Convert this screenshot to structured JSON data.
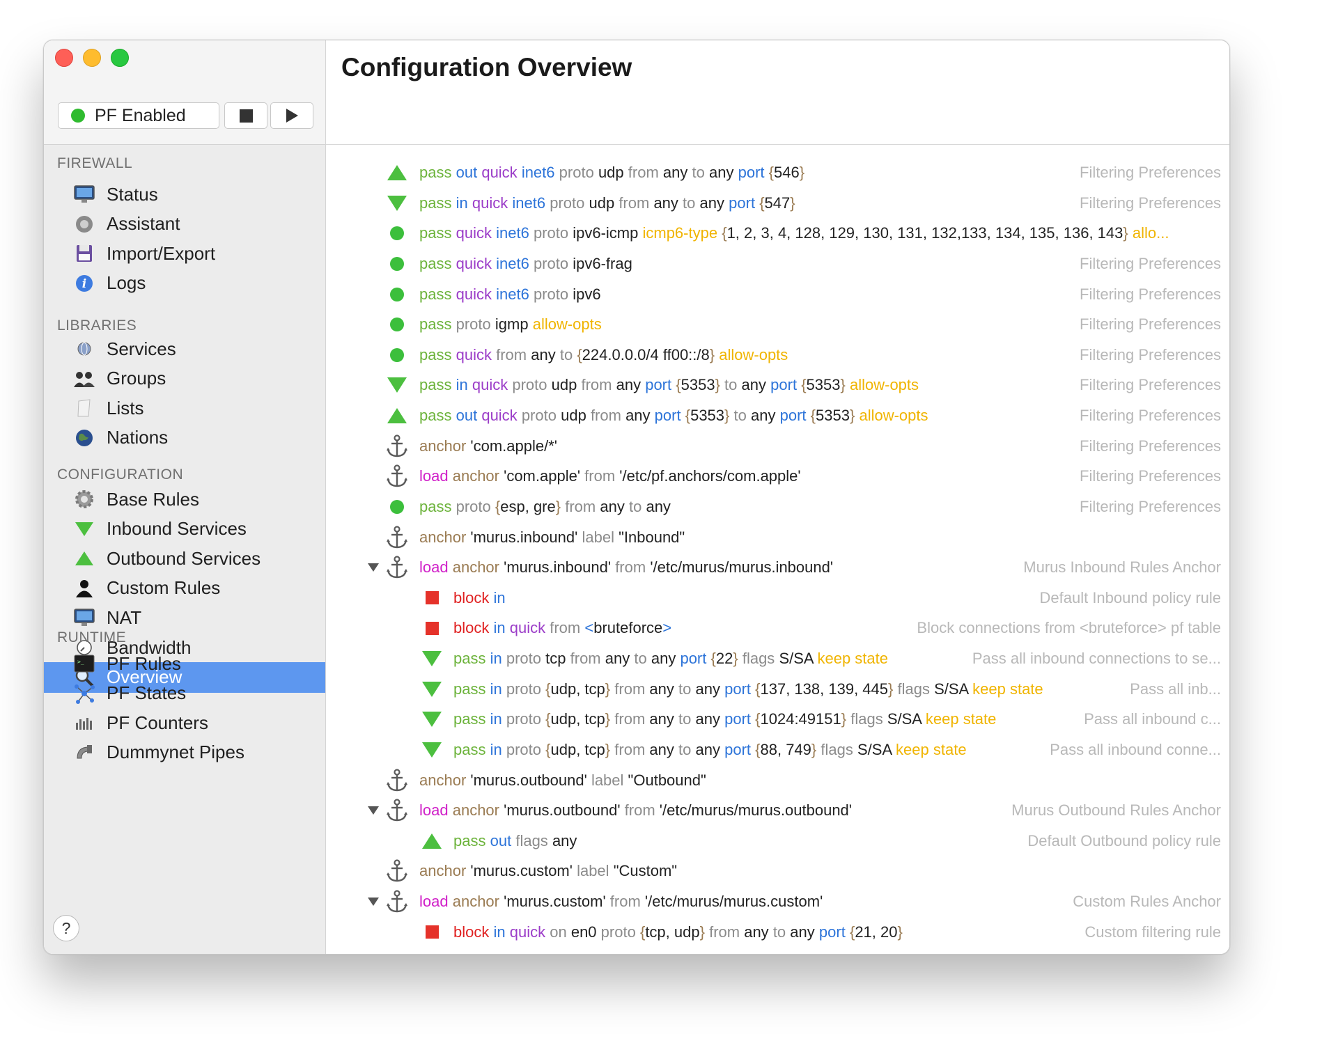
{
  "window": {
    "pf_status": "PF Enabled",
    "title": "Configuration Overview"
  },
  "sidebar": {
    "sections": [
      {
        "label": "FIREWALL",
        "items": [
          {
            "label": "Status",
            "icon": "monitor-icon"
          },
          {
            "label": "Assistant",
            "icon": "assistant-icon"
          },
          {
            "label": "Import/Export",
            "icon": "disk-icon"
          },
          {
            "label": "Logs",
            "icon": "info-icon"
          }
        ]
      },
      {
        "label": "LIBRARIES",
        "items": [
          {
            "label": "Services",
            "icon": "globe-icon"
          },
          {
            "label": "Groups",
            "icon": "group-icon"
          },
          {
            "label": "Lists",
            "icon": "list-icon"
          },
          {
            "label": "Nations",
            "icon": "earth-icon"
          }
        ]
      },
      {
        "label": "CONFIGURATION",
        "items": [
          {
            "label": "Base Rules",
            "icon": "gear-icon"
          },
          {
            "label": "Inbound Services",
            "icon": "down-triangle-icon"
          },
          {
            "label": "Outbound Services",
            "icon": "up-triangle-icon"
          },
          {
            "label": "Custom Rules",
            "icon": "user-icon"
          },
          {
            "label": "NAT",
            "icon": "monitor-icon"
          },
          {
            "label": "Bandwidth",
            "icon": "gauge-icon"
          },
          {
            "label": "Overview",
            "icon": "magnifier-icon",
            "selected": true
          }
        ]
      },
      {
        "label": "RUNTIME",
        "items": [
          {
            "label": "PF Rules",
            "icon": "terminal-icon"
          },
          {
            "label": "PF States",
            "icon": "network-icon"
          },
          {
            "label": "PF Counters",
            "icon": "bars-icon"
          },
          {
            "label": "Dummynet Pipes",
            "icon": "pipe-icon"
          }
        ]
      }
    ],
    "help": "?"
  },
  "rules": [
    {
      "icon": "up",
      "indent": 0,
      "tokens": [
        [
          "pass",
          "pass"
        ],
        [
          "dir",
          "out"
        ],
        [
          "q",
          "quick"
        ],
        [
          "af",
          "inet6"
        ],
        [
          "kw",
          "proto"
        ],
        [
          "v",
          "udp"
        ],
        [
          "kw",
          "from"
        ],
        [
          "v",
          "any"
        ],
        [
          "kw",
          "to"
        ],
        [
          "v",
          "any"
        ],
        [
          "dir",
          "port"
        ],
        [
          "br",
          "{"
        ],
        [
          "v",
          "546"
        ],
        [
          "br",
          "}"
        ]
      ],
      "note": "Filtering Preferences"
    },
    {
      "icon": "down",
      "indent": 0,
      "tokens": [
        [
          "pass",
          "pass"
        ],
        [
          "dir",
          "in"
        ],
        [
          "q",
          "quick"
        ],
        [
          "af",
          "inet6"
        ],
        [
          "kw",
          "proto"
        ],
        [
          "v",
          "udp"
        ],
        [
          "kw",
          "from"
        ],
        [
          "v",
          "any"
        ],
        [
          "kw",
          "to"
        ],
        [
          "v",
          "any"
        ],
        [
          "dir",
          "port"
        ],
        [
          "br",
          "{"
        ],
        [
          "v",
          "547"
        ],
        [
          "br",
          "}"
        ]
      ],
      "note": "Filtering Preferences"
    },
    {
      "icon": "dot",
      "indent": 0,
      "tokens": [
        [
          "pass",
          "pass"
        ],
        [
          "q",
          "quick"
        ],
        [
          "af",
          "inet6"
        ],
        [
          "kw",
          "proto"
        ],
        [
          "v",
          "ipv6-icmp"
        ],
        [
          "y",
          "icmp6-type"
        ],
        [
          "br",
          "{"
        ],
        [
          "v",
          "1, 2, 3, 4, 128, 129, 130, 131, 132,133, 134, 135, 136, 143"
        ],
        [
          "br",
          "}"
        ],
        [
          "y",
          "allo..."
        ]
      ],
      "note": ""
    },
    {
      "icon": "dot",
      "indent": 0,
      "tokens": [
        [
          "pass",
          "pass"
        ],
        [
          "q",
          "quick"
        ],
        [
          "af",
          "inet6"
        ],
        [
          "kw",
          "proto"
        ],
        [
          "v",
          "ipv6-frag"
        ]
      ],
      "note": "Filtering Preferences"
    },
    {
      "icon": "dot",
      "indent": 0,
      "tokens": [
        [
          "pass",
          "pass"
        ],
        [
          "q",
          "quick"
        ],
        [
          "af",
          "inet6"
        ],
        [
          "kw",
          "proto"
        ],
        [
          "v",
          "ipv6"
        ]
      ],
      "note": "Filtering Preferences"
    },
    {
      "icon": "dot",
      "indent": 0,
      "tokens": [
        [
          "pass",
          "pass"
        ],
        [
          "kw",
          "proto"
        ],
        [
          "v",
          "igmp"
        ],
        [
          "y",
          "allow-opts"
        ]
      ],
      "note": "Filtering Preferences"
    },
    {
      "icon": "dot",
      "indent": 0,
      "tokens": [
        [
          "pass",
          "pass"
        ],
        [
          "q",
          "quick"
        ],
        [
          "kw",
          "from"
        ],
        [
          "v",
          "any"
        ],
        [
          "kw",
          "to"
        ],
        [
          "br",
          "{"
        ],
        [
          "v",
          "224.0.0.0/4 ff00::/8"
        ],
        [
          "br",
          "}"
        ],
        [
          "y",
          "allow-opts"
        ]
      ],
      "note": "Filtering Preferences"
    },
    {
      "icon": "down",
      "indent": 0,
      "tokens": [
        [
          "pass",
          "pass"
        ],
        [
          "dir",
          "in"
        ],
        [
          "q",
          "quick"
        ],
        [
          "kw",
          "proto"
        ],
        [
          "v",
          "udp"
        ],
        [
          "kw",
          "from"
        ],
        [
          "v",
          "any"
        ],
        [
          "dir",
          "port"
        ],
        [
          "br",
          "{"
        ],
        [
          "v",
          "5353"
        ],
        [
          "br",
          "}"
        ],
        [
          "kw",
          "to"
        ],
        [
          "v",
          "any"
        ],
        [
          "dir",
          "port"
        ],
        [
          "br",
          "{"
        ],
        [
          "v",
          "5353"
        ],
        [
          "br",
          "}"
        ],
        [
          "y",
          "allow-opts"
        ]
      ],
      "note": "Filtering Preferences"
    },
    {
      "icon": "up",
      "indent": 0,
      "tokens": [
        [
          "pass",
          "pass"
        ],
        [
          "dir",
          "out"
        ],
        [
          "q",
          "quick"
        ],
        [
          "kw",
          "proto"
        ],
        [
          "v",
          "udp"
        ],
        [
          "kw",
          "from"
        ],
        [
          "v",
          "any"
        ],
        [
          "dir",
          "port"
        ],
        [
          "br",
          "{"
        ],
        [
          "v",
          "5353"
        ],
        [
          "br",
          "}"
        ],
        [
          "kw",
          "to"
        ],
        [
          "v",
          "any"
        ],
        [
          "dir",
          "port"
        ],
        [
          "br",
          "{"
        ],
        [
          "v",
          "5353"
        ],
        [
          "br",
          "}"
        ],
        [
          "y",
          "allow-opts"
        ]
      ],
      "note": "Filtering Preferences"
    },
    {
      "icon": "anchor",
      "indent": 0,
      "tokens": [
        [
          "anchor",
          "anchor"
        ],
        [
          "v",
          "'com.apple/*'"
        ]
      ],
      "note": "Filtering Preferences"
    },
    {
      "icon": "anchor",
      "indent": 0,
      "tokens": [
        [
          "load",
          "load"
        ],
        [
          "anchor",
          "anchor"
        ],
        [
          "v",
          "'com.apple'"
        ],
        [
          "kw",
          "from"
        ],
        [
          "v",
          "'/etc/pf.anchors/com.apple'"
        ]
      ],
      "note": "Filtering Preferences"
    },
    {
      "icon": "dot",
      "indent": 0,
      "tokens": [
        [
          "pass",
          "pass"
        ],
        [
          "kw",
          "proto"
        ],
        [
          "br",
          "{"
        ],
        [
          "v",
          "esp, gre"
        ],
        [
          "br",
          "}"
        ],
        [
          "kw",
          "from"
        ],
        [
          "v",
          "any"
        ],
        [
          "kw",
          "to"
        ],
        [
          "v",
          "any"
        ]
      ],
      "note": "Filtering Preferences"
    },
    {
      "icon": "anchor",
      "indent": 0,
      "tokens": [
        [
          "anchor",
          "anchor"
        ],
        [
          "v",
          "'murus.inbound'"
        ],
        [
          "kw",
          "label"
        ],
        [
          "v",
          "\"Inbound\""
        ]
      ],
      "note": ""
    },
    {
      "icon": "anchor",
      "indent": 0,
      "disclosure": true,
      "tokens": [
        [
          "load",
          "load"
        ],
        [
          "anchor",
          "anchor"
        ],
        [
          "v",
          "'murus.inbound'"
        ],
        [
          "kw",
          "from"
        ],
        [
          "v",
          "'/etc/murus/murus.inbound'"
        ]
      ],
      "note": "Murus Inbound Rules Anchor"
    },
    {
      "icon": "sq",
      "indent": 1,
      "tokens": [
        [
          "block",
          "block"
        ],
        [
          "dir",
          "in"
        ]
      ],
      "note": "Default Inbound policy rule"
    },
    {
      "icon": "sq",
      "indent": 1,
      "tokens": [
        [
          "block",
          "block"
        ],
        [
          "dir",
          "in"
        ],
        [
          "q",
          "quick"
        ],
        [
          "kw",
          "from"
        ],
        [
          "dir",
          "<"
        ],
        [
          "v",
          "bruteforce"
        ],
        [
          "dir",
          ">"
        ]
      ],
      "note": "Block connections from <bruteforce> pf table"
    },
    {
      "icon": "down",
      "indent": 1,
      "tokens": [
        [
          "pass",
          "pass"
        ],
        [
          "dir",
          "in"
        ],
        [
          "kw",
          "proto"
        ],
        [
          "v",
          "tcp"
        ],
        [
          "kw",
          "from"
        ],
        [
          "v",
          "any"
        ],
        [
          "kw",
          "to"
        ],
        [
          "v",
          "any"
        ],
        [
          "dir",
          "port"
        ],
        [
          "br",
          "{"
        ],
        [
          "v",
          "22"
        ],
        [
          "br",
          "}"
        ],
        [
          "kw",
          "flags"
        ],
        [
          "v",
          "S/SA"
        ],
        [
          "y",
          "keep state"
        ]
      ],
      "note": "Pass all inbound connections to se..."
    },
    {
      "icon": "down",
      "indent": 1,
      "tokens": [
        [
          "pass",
          "pass"
        ],
        [
          "dir",
          "in"
        ],
        [
          "kw",
          "proto"
        ],
        [
          "br",
          "{"
        ],
        [
          "v",
          "udp, tcp"
        ],
        [
          "br",
          "}"
        ],
        [
          "kw",
          "from"
        ],
        [
          "v",
          "any"
        ],
        [
          "kw",
          "to"
        ],
        [
          "v",
          "any"
        ],
        [
          "dir",
          "port"
        ],
        [
          "br",
          "{"
        ],
        [
          "v",
          "137, 138, 139, 445"
        ],
        [
          "br",
          "}"
        ],
        [
          "kw",
          "flags"
        ],
        [
          "v",
          "S/SA"
        ],
        [
          "y",
          "keep state"
        ]
      ],
      "note": "Pass all inb..."
    },
    {
      "icon": "down",
      "indent": 1,
      "tokens": [
        [
          "pass",
          "pass"
        ],
        [
          "dir",
          "in"
        ],
        [
          "kw",
          "proto"
        ],
        [
          "br",
          "{"
        ],
        [
          "v",
          "udp, tcp"
        ],
        [
          "br",
          "}"
        ],
        [
          "kw",
          "from"
        ],
        [
          "v",
          "any"
        ],
        [
          "kw",
          "to"
        ],
        [
          "v",
          "any"
        ],
        [
          "dir",
          "port"
        ],
        [
          "br",
          "{"
        ],
        [
          "v",
          "1024:49151"
        ],
        [
          "br",
          "}"
        ],
        [
          "kw",
          "flags"
        ],
        [
          "v",
          "S/SA"
        ],
        [
          "y",
          "keep state"
        ]
      ],
      "note": "Pass all inbound c..."
    },
    {
      "icon": "down",
      "indent": 1,
      "tokens": [
        [
          "pass",
          "pass"
        ],
        [
          "dir",
          "in"
        ],
        [
          "kw",
          "proto"
        ],
        [
          "br",
          "{"
        ],
        [
          "v",
          "udp, tcp"
        ],
        [
          "br",
          "}"
        ],
        [
          "kw",
          "from"
        ],
        [
          "v",
          "any"
        ],
        [
          "kw",
          "to"
        ],
        [
          "v",
          "any"
        ],
        [
          "dir",
          "port"
        ],
        [
          "br",
          "{"
        ],
        [
          "v",
          "88, 749"
        ],
        [
          "br",
          "}"
        ],
        [
          "kw",
          "flags"
        ],
        [
          "v",
          "S/SA"
        ],
        [
          "y",
          "keep state"
        ]
      ],
      "note": "Pass all inbound conne..."
    },
    {
      "icon": "anchor",
      "indent": 0,
      "tokens": [
        [
          "anchor",
          "anchor"
        ],
        [
          "v",
          "'murus.outbound'"
        ],
        [
          "kw",
          "label"
        ],
        [
          "v",
          "\"Outbound\""
        ]
      ],
      "note": ""
    },
    {
      "icon": "anchor",
      "indent": 0,
      "disclosure": true,
      "tokens": [
        [
          "load",
          "load"
        ],
        [
          "anchor",
          "anchor"
        ],
        [
          "v",
          "'murus.outbound'"
        ],
        [
          "kw",
          "from"
        ],
        [
          "v",
          "'/etc/murus/murus.outbound'"
        ]
      ],
      "note": "Murus Outbound Rules Anchor"
    },
    {
      "icon": "up",
      "indent": 1,
      "tokens": [
        [
          "pass",
          "pass"
        ],
        [
          "dir",
          "out"
        ],
        [
          "kw",
          "flags"
        ],
        [
          "v",
          "any"
        ]
      ],
      "note": "Default Outbound policy rule"
    },
    {
      "icon": "anchor",
      "indent": 0,
      "tokens": [
        [
          "anchor",
          "anchor"
        ],
        [
          "v",
          "'murus.custom'"
        ],
        [
          "kw",
          "label"
        ],
        [
          "v",
          "\"Custom\""
        ]
      ],
      "note": ""
    },
    {
      "icon": "anchor",
      "indent": 0,
      "disclosure": true,
      "tokens": [
        [
          "load",
          "load"
        ],
        [
          "anchor",
          "anchor"
        ],
        [
          "v",
          "'murus.custom'"
        ],
        [
          "kw",
          "from"
        ],
        [
          "v",
          "'/etc/murus/murus.custom'"
        ]
      ],
      "note": "Custom Rules Anchor"
    },
    {
      "icon": "sq",
      "indent": 1,
      "tokens": [
        [
          "block",
          "block"
        ],
        [
          "dir",
          "in"
        ],
        [
          "q",
          "quick"
        ],
        [
          "kw",
          "on"
        ],
        [
          "v",
          "en0"
        ],
        [
          "kw",
          "proto"
        ],
        [
          "br",
          "{"
        ],
        [
          "v",
          "tcp, udp"
        ],
        [
          "br",
          "}"
        ],
        [
          "kw",
          "from"
        ],
        [
          "v",
          "any"
        ],
        [
          "kw",
          "to"
        ],
        [
          "v",
          "any"
        ],
        [
          "dir",
          "port"
        ],
        [
          "br",
          "{"
        ],
        [
          "v",
          "21, 20"
        ],
        [
          "br",
          "}"
        ]
      ],
      "note": "Custom filtering rule"
    }
  ]
}
